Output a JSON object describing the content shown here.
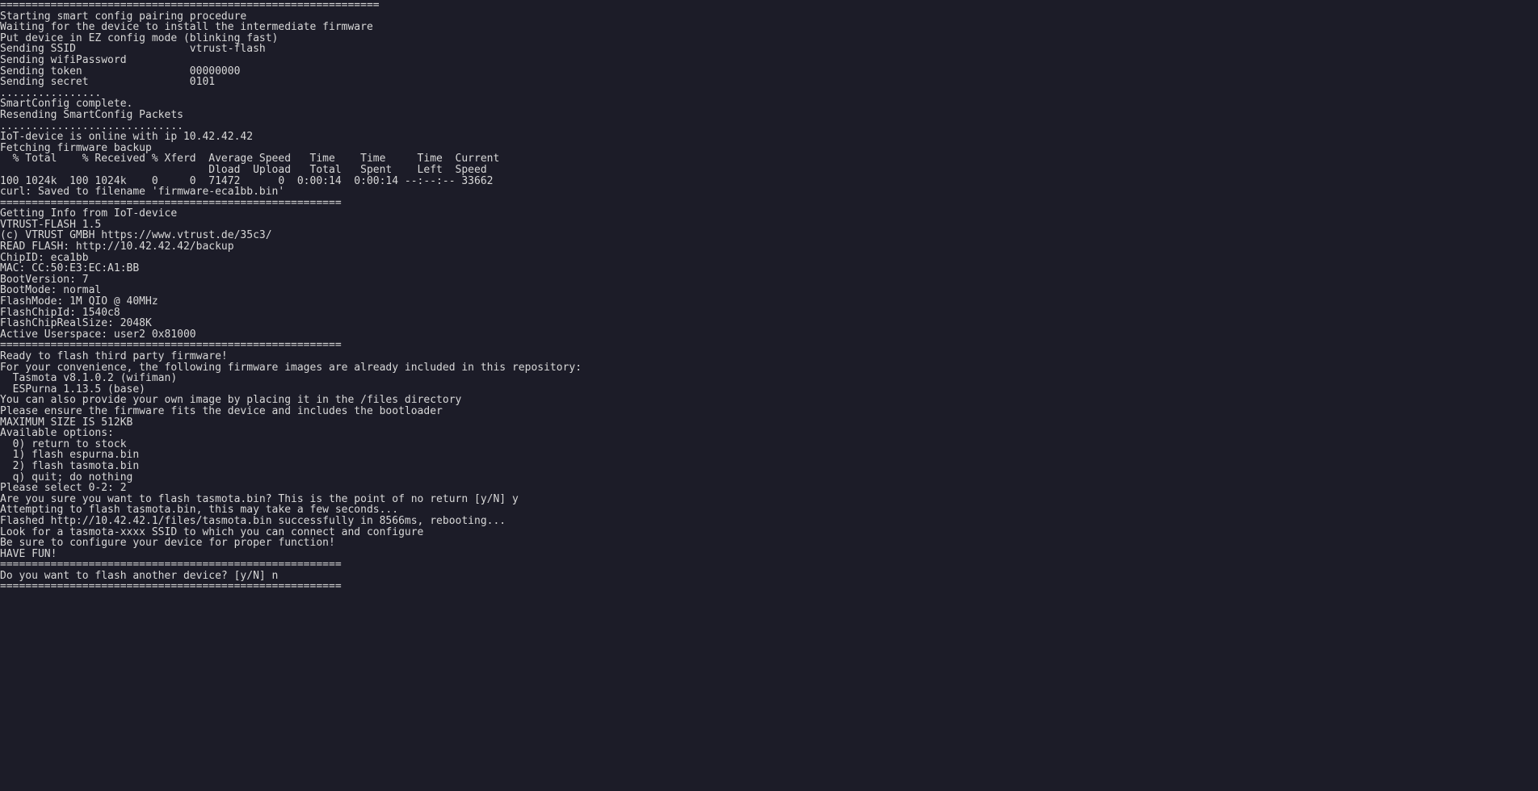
{
  "terminal": {
    "lines": [
      "============================================================",
      "Starting smart config pairing procedure",
      "Waiting for the device to install the intermediate firmware",
      "Put device in EZ config mode (blinking fast)",
      "Sending SSID                  vtrust-flash",
      "Sending wifiPassword          ",
      "Sending token                 00000000",
      "Sending secret                0101",
      "................",
      "SmartConfig complete.",
      "Resending SmartConfig Packets",
      ".............................",
      "IoT-device is online with ip 10.42.42.42",
      "Fetching firmware backup",
      "  % Total    % Received % Xferd  Average Speed   Time    Time     Time  Current",
      "                                 Dload  Upload   Total   Spent    Left  Speed",
      "100 1024k  100 1024k    0     0  71472      0  0:00:14  0:00:14 --:--:-- 33662",
      "curl: Saved to filename 'firmware-eca1bb.bin'",
      "======================================================",
      "Getting Info from IoT-device",
      "VTRUST-FLASH 1.5",
      "(c) VTRUST GMBH https://www.vtrust.de/35c3/",
      "READ FLASH: http://10.42.42.42/backup",
      "ChipID: eca1bb",
      "MAC: CC:50:E3:EC:A1:BB",
      "BootVersion: 7",
      "BootMode: normal",
      "FlashMode: 1M QIO @ 40MHz",
      "FlashChipId: 1540c8",
      "FlashChipRealSize: 2048K",
      "Active Userspace: user2 0x81000",
      "======================================================",
      "Ready to flash third party firmware!",
      "",
      "For your convenience, the following firmware images are already included in this repository:",
      "  Tasmota v8.1.0.2 (wifiman)",
      "  ESPurna 1.13.5 (base)",
      "",
      "You can also provide your own image by placing it in the /files directory",
      "Please ensure the firmware fits the device and includes the bootloader",
      "MAXIMUM SIZE IS 512KB",
      "",
      "Available options:",
      "  0) return to stock",
      "  1) flash espurna.bin",
      "  2) flash tasmota.bin",
      "  q) quit; do nothing",
      "Please select 0-2: 2",
      "Are you sure you want to flash tasmota.bin? This is the point of no return [y/N] y",
      "Attempting to flash tasmota.bin, this may take a few seconds...",
      "Flashed http://10.42.42.1/files/tasmota.bin successfully in 8566ms, rebooting...",
      "Look for a tasmota-xxxx SSID to which you can connect and configure",
      "Be sure to configure your device for proper function!",
      "",
      "HAVE FUN!",
      "======================================================",
      "Do you want to flash another device? [y/N] n",
      "======================================================"
    ]
  }
}
